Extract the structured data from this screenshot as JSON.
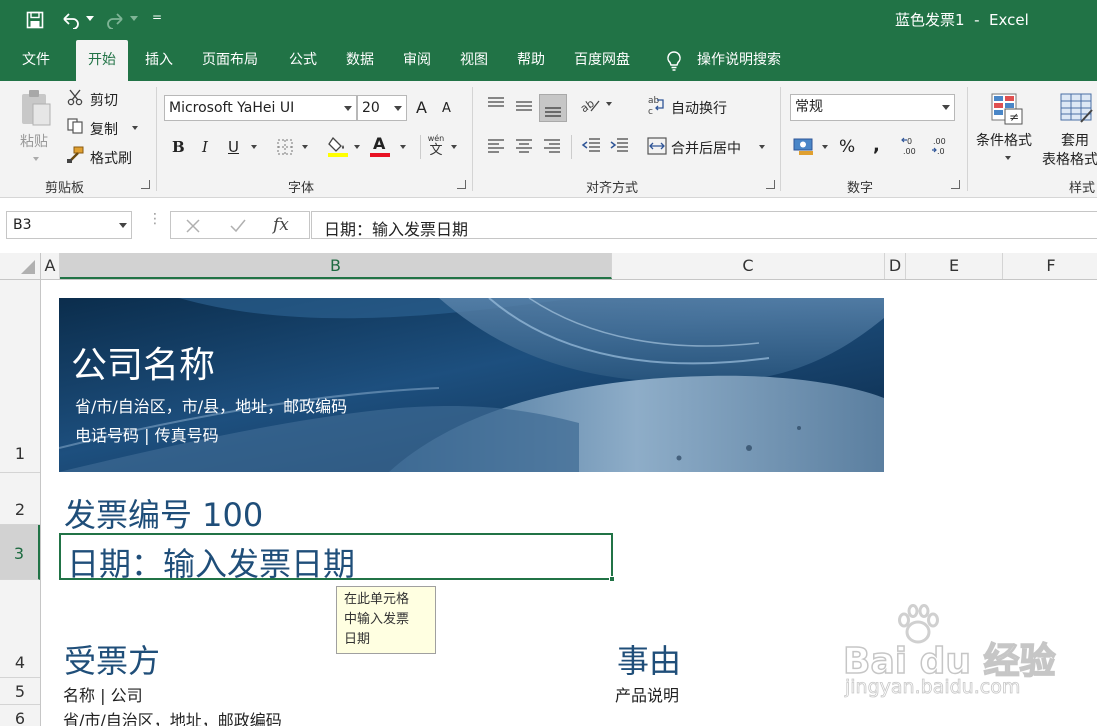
{
  "titlebar": {
    "title": "蓝色发票1  -  Excel",
    "qat_more": "="
  },
  "tabs": [
    "文件",
    "开始",
    "插入",
    "页面布局",
    "公式",
    "数据",
    "审阅",
    "视图",
    "帮助",
    "百度网盘",
    "操作说明搜索"
  ],
  "ribbon": {
    "clipboard": {
      "paste": "粘贴",
      "cut": "剪切",
      "copy": "复制",
      "format_painter": "格式刷",
      "label": "剪贴板"
    },
    "font": {
      "name": "Microsoft YaHei UI",
      "size": "20",
      "bold": "B",
      "italic": "I",
      "underline": "U",
      "label": "字体",
      "grow": "A",
      "shrink": "A",
      "phonetic": "wén"
    },
    "alignment": {
      "wrap": "自动换行",
      "merge": "合并后居中",
      "label": "对齐方式"
    },
    "number": {
      "format": "常规",
      "label": "数字",
      "percent": "%",
      "comma": ",",
      "inc_decimal": "+.0 .00",
      "dec_decimal": ".00 →.0"
    },
    "styles": {
      "conditional": "条件格式",
      "table_format_1": "套用",
      "table_format_2": "表格格式",
      "label": "样式"
    }
  },
  "formula_bar": {
    "name_box": "B3",
    "content": "日期：输入发票日期",
    "fx": "fx"
  },
  "columns": [
    "A",
    "B",
    "C",
    "D",
    "E",
    "F"
  ],
  "rows": [
    "1",
    "2",
    "3",
    "4",
    "5",
    "6"
  ],
  "sheet": {
    "company_name": "公司名称",
    "address": "省/市/自治区，市/县，地址，邮政编码",
    "phone": "电话号码 | 传真号码",
    "invoice_number": "发票编号 100",
    "date": "日期：输入发票日期",
    "tooltip": [
      "在此单元格",
      "中输入发票",
      "日期"
    ],
    "recipient_heading": "受票方",
    "recipient_name": "名称 | 公司",
    "recipient_address": "省/市/自治区，地址，邮政编码",
    "reason_heading": "事由",
    "product_desc": "产品说明"
  },
  "watermark": {
    "logo": "Bai du 经验",
    "url": "jingyan.baidu.com"
  },
  "colors": {
    "excel_green": "#217346",
    "heading_blue": "#1f4e79",
    "ribbon_bg": "#f3f3f3"
  }
}
